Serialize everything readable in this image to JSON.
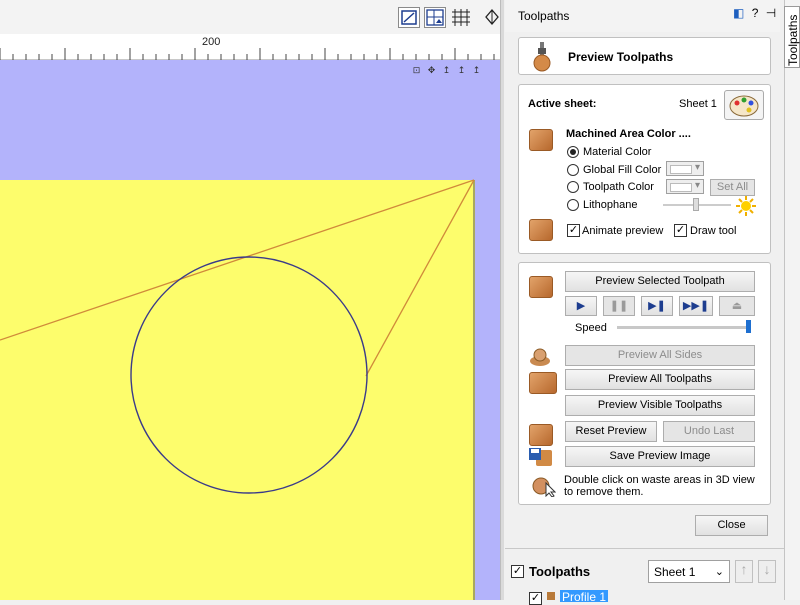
{
  "view": {
    "ruler_label": "200",
    "toolbar_icons": [
      "zoom-extents-icon",
      "view-layout-icon",
      "grid-icon",
      "pan-icon"
    ],
    "view_icons": [
      "zoom-icon",
      "pan-icon",
      "z-axis-icon",
      "x-axis-icon",
      "y-axis-icon"
    ],
    "view_icon_glyphs": [
      "⊡",
      "✥",
      "↥",
      "↥",
      "↥"
    ]
  },
  "panel": {
    "title": "Toolpaths",
    "side_tab_label": "Toolpaths",
    "header_icons": [
      "◧",
      "?",
      "⊣",
      "✕"
    ],
    "preview_title": "Preview Toolpaths",
    "active_sheet_label": "Active sheet:",
    "active_sheet_value": "Sheet 1",
    "machined_area_label": "Machined Area Color ....",
    "color_options": [
      {
        "label": "Material Color",
        "selected": true
      },
      {
        "label": "Global Fill Color",
        "selected": false
      },
      {
        "label": "Toolpath Color",
        "selected": false
      },
      {
        "label": "Lithophane",
        "selected": false
      }
    ],
    "set_all_label": "Set All",
    "animate_preview_label": "Animate preview",
    "animate_preview_checked": true,
    "draw_tool_label": "Draw tool",
    "draw_tool_checked": true,
    "preview_selected_label": "Preview Selected Toolpath",
    "playback": {
      "play": "▶",
      "pause": "❚❚",
      "step": "▶❚",
      "fast_forward": "▶▶❚",
      "eject": "⏏"
    },
    "speed_label": "Speed",
    "speed_level": 1.0,
    "preview_all_sides_label": "Preview All Sides",
    "preview_all_toolpaths_label": "Preview All Toolpaths",
    "preview_visible_label": "Preview Visible Toolpaths",
    "reset_preview_label": "Reset Preview",
    "undo_last_label": "Undo Last",
    "save_image_label": "Save Preview Image",
    "hint_line1": "Double click on waste areas in 3D view",
    "hint_line2": "to remove them.",
    "close_label": "Close",
    "list_title": "Toolpaths",
    "list_checked": true,
    "sheet_select_value": "Sheet 1",
    "first_toolpath": "Profile 1"
  },
  "colors": {
    "material": "#fdfd6c",
    "background": "#b3b3fb",
    "toolpath_line": "#d08a3a",
    "circle": "#3a3a8a",
    "selection": "#3399ff"
  }
}
